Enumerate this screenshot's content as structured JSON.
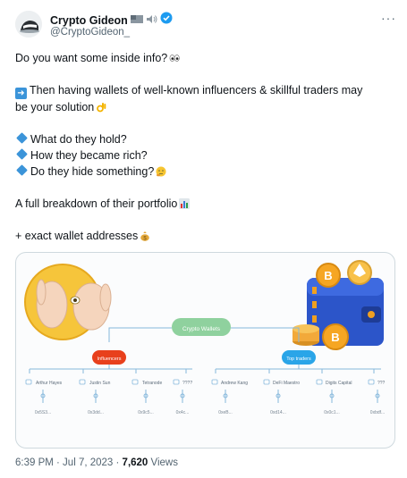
{
  "author": {
    "name": "Crypto Gideon",
    "handle": "@CryptoGideon_",
    "verified": true
  },
  "more_icon": "more-horizontal-icon",
  "tweet_lines": {
    "l1": "Do you want some inside info?",
    "l2a": "Then having wallets of well-known influencers & skillful traders may",
    "l2b": "be your solution",
    "q1": "What do they hold?",
    "q2": "How they became rich?",
    "q3": "Do they hide something?",
    "l4": "A full breakdown of their portfolio",
    "l5": "+ exact wallet addresses"
  },
  "diagram": {
    "root": "Crypto Wallets",
    "left_group": "Influencers",
    "right_group": "Top traders",
    "left_people": [
      {
        "name": "Arthur Hayes",
        "addr": "0x5S3..."
      },
      {
        "name": "Justin Sun",
        "addr": "0x3dd..."
      },
      {
        "name": "Tetranode",
        "addr": "0x9c5..."
      },
      {
        "name": "????",
        "addr": "0x4c..."
      }
    ],
    "right_people": [
      {
        "name": "Andrew Kang",
        "addr": "0xeB..."
      },
      {
        "name": "DeFi Maestro",
        "addr": "0xd14..."
      },
      {
        "name": "Digits Capital",
        "addr": "0x0c1..."
      },
      {
        "name": "???",
        "addr": "0xbdf..."
      }
    ],
    "colors": {
      "root": "#8fd19e",
      "influencers": "#e8401c",
      "traders": "#2aa5e8",
      "line": "#86b8dc"
    }
  },
  "meta": {
    "time": "6:39 PM · Jul 7, 2023 · ",
    "views_count": "7,620",
    "views_label": " Views"
  }
}
